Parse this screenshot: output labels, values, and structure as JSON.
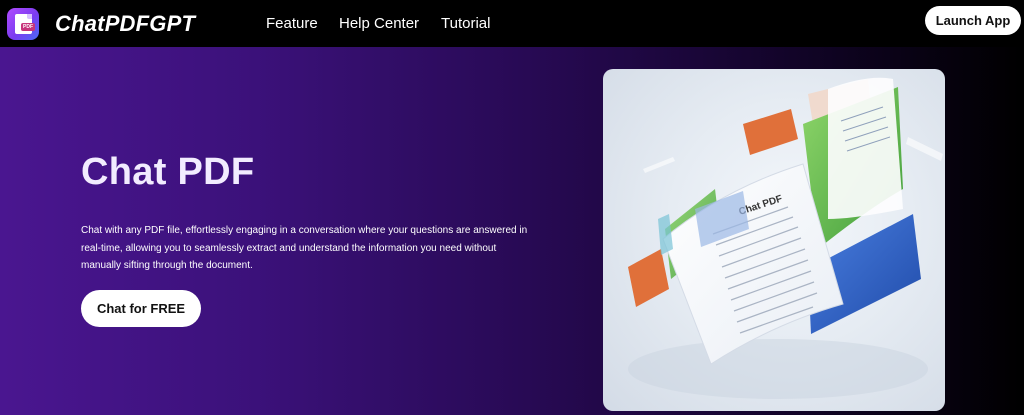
{
  "header": {
    "logo_badge": "PDF",
    "brand": "ChatPDFGPT",
    "nav": [
      {
        "label": "Feature"
      },
      {
        "label": "Help Center"
      },
      {
        "label": "Tutorial"
      }
    ],
    "launch_label": "Launch App"
  },
  "hero": {
    "title": "Chat PDF",
    "description": "Chat with any PDF file, effortlessly engaging in a conversation where your questions are answered in real-time, allowing you to seamlessly extract and understand the information you need without manually sifting through the document.",
    "cta_label": "Chat for FREE"
  },
  "illustration": {
    "doc_title": "Chat PDF"
  },
  "colors": {
    "hero_gradient_start": "#4a1690",
    "hero_gradient_end": "#000000",
    "panel_green": "#5fbf4a",
    "panel_blue": "#2f5fc4",
    "panel_orange": "#e0703a"
  }
}
